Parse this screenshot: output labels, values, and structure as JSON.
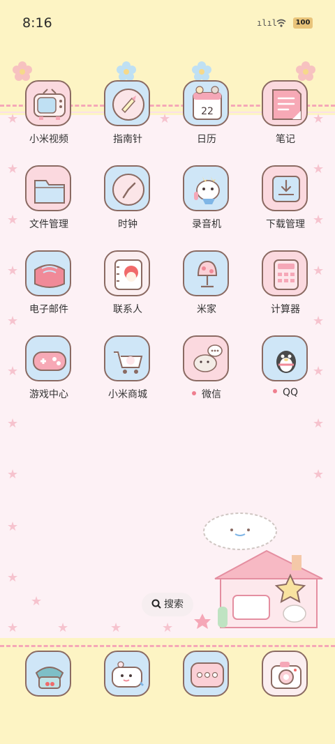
{
  "status_bar": {
    "time": "8:16",
    "signal": "ılıl",
    "battery": "100"
  },
  "apps": [
    {
      "label": "小米视频",
      "notify": false,
      "icon": "tv-icon"
    },
    {
      "label": "指南针",
      "notify": false,
      "icon": "compass-icon"
    },
    {
      "label": "日历",
      "notify": false,
      "icon": "calendar-icon",
      "date": "22"
    },
    {
      "label": "笔记",
      "notify": false,
      "icon": "notes-icon"
    },
    {
      "label": "文件管理",
      "notify": false,
      "icon": "folder-icon"
    },
    {
      "label": "时钟",
      "notify": false,
      "icon": "clock-icon"
    },
    {
      "label": "录音机",
      "notify": false,
      "icon": "recorder-icon"
    },
    {
      "label": "下载管理",
      "notify": false,
      "icon": "download-icon"
    },
    {
      "label": "电子邮件",
      "notify": false,
      "icon": "mail-icon"
    },
    {
      "label": "联系人",
      "notify": false,
      "icon": "contacts-icon"
    },
    {
      "label": "米家",
      "notify": false,
      "icon": "lamp-icon"
    },
    {
      "label": "计算器",
      "notify": false,
      "icon": "calculator-icon"
    },
    {
      "label": "游戏中心",
      "notify": false,
      "icon": "gamepad-icon"
    },
    {
      "label": "小米商城",
      "notify": false,
      "icon": "cart-icon"
    },
    {
      "label": "微信",
      "notify": true,
      "icon": "wechat-icon"
    },
    {
      "label": "QQ",
      "notify": true,
      "icon": "qq-penguin-icon"
    }
  ],
  "search": {
    "label": "搜索"
  },
  "dock": [
    {
      "icon": "phone-icon"
    },
    {
      "icon": "messages-icon"
    },
    {
      "icon": "more-icon"
    },
    {
      "icon": "camera-icon"
    }
  ],
  "colors": {
    "pink": "#f5a7b7",
    "yellow": "#fdf4c4",
    "blue": "#cfe6f7",
    "outline": "#8a6a62"
  }
}
